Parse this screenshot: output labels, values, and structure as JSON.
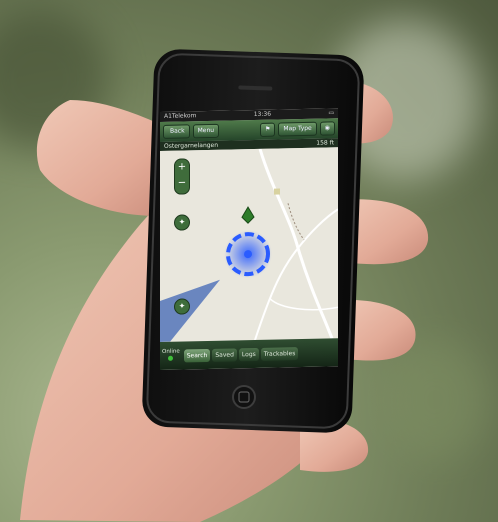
{
  "status_bar": {
    "carrier": "A1Telekom",
    "time": "13:36",
    "battery": ""
  },
  "toolbar": {
    "back": "Back",
    "menu": "Menu",
    "map_type": "Map Type"
  },
  "title_bar": {
    "title": "Ostergarnelangen",
    "distance": "158 ft"
  },
  "tabs": [
    {
      "label": "Search",
      "active": true
    },
    {
      "label": "Saved",
      "active": false
    },
    {
      "label": "Logs",
      "active": false
    },
    {
      "label": "Trackables",
      "active": false
    }
  ],
  "online": {
    "label": "Online"
  },
  "colors": {
    "toolbar_green": "#2f5534",
    "location_blue": "#2a5cff",
    "cache_green": "#2e7d2a",
    "map_bg": "#e9e7dd",
    "water_blue": "#6a86bf"
  },
  "icons": [
    "flag-icon",
    "location-icon",
    "geocache-marker-icon",
    "zoom-in-icon",
    "zoom-out-icon",
    "compass-icon",
    "home-button-icon"
  ]
}
